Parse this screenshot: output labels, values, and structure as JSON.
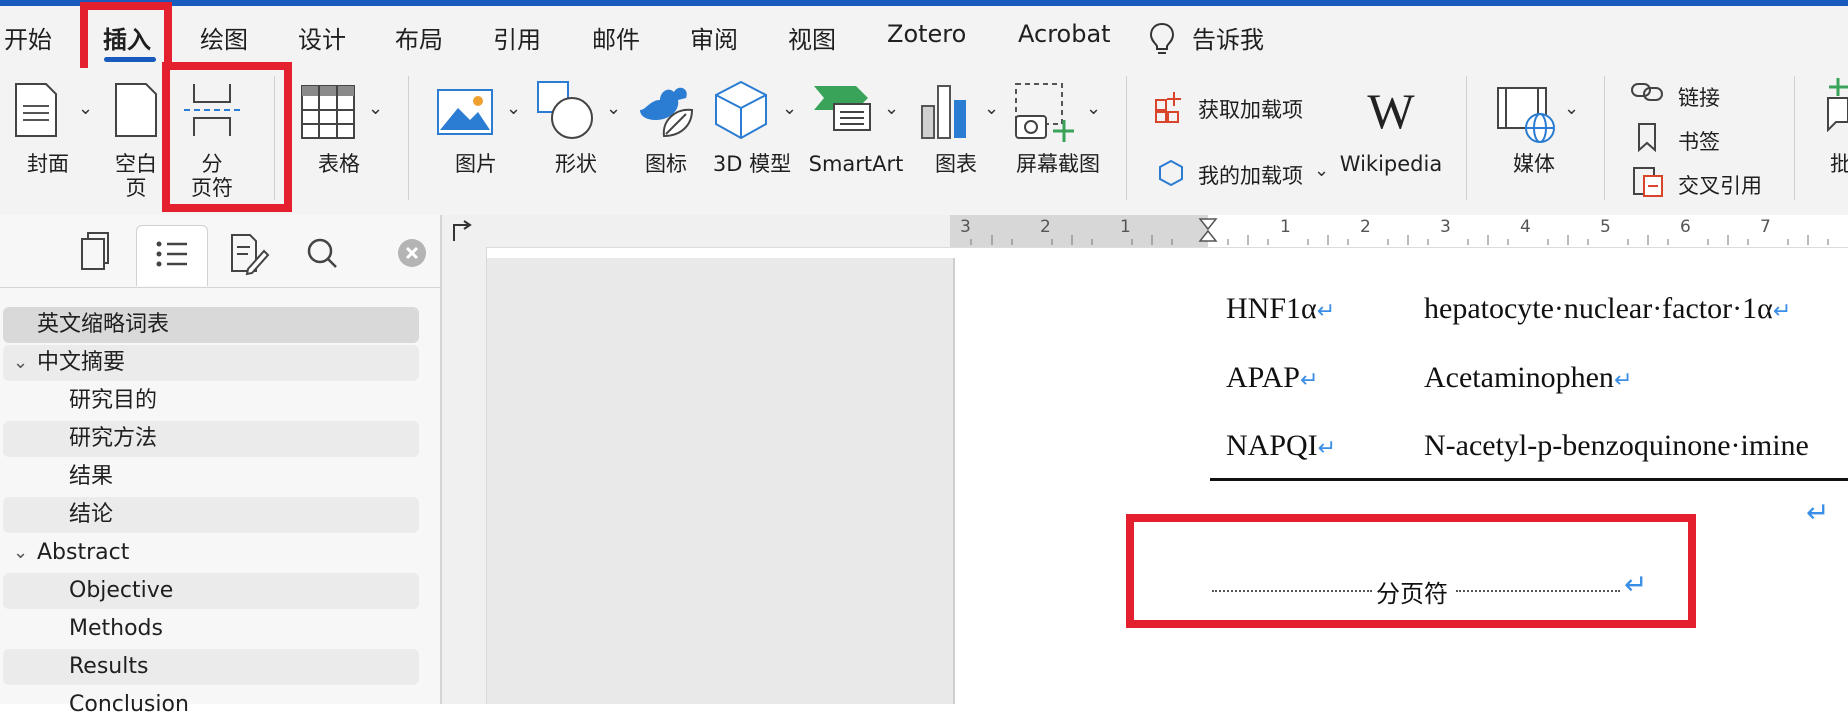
{
  "ribbon_tabs": [
    "开始",
    "插入",
    "绘图",
    "设计",
    "布局",
    "引用",
    "邮件",
    "审阅",
    "视图",
    "Zotero",
    "Acrobat",
    "告诉我"
  ],
  "active_tab": "插入",
  "ribbon": {
    "cover": "封面",
    "blank_page": [
      "空白",
      "页"
    ],
    "page_break": [
      "分",
      "页符"
    ],
    "table": "表格",
    "pictures": "图片",
    "shapes": "形状",
    "icons": "图标",
    "model3d": "3D 模型",
    "smartart": "SmartArt",
    "chart": "图表",
    "screenshot": "屏幕截图",
    "get_addins": "获取加载项",
    "my_addins": "我的加载项",
    "wikipedia_logo": "W",
    "wikipedia": "Wikipedia",
    "media": "媒体",
    "link": "链接",
    "bookmark": "书签",
    "cross_reference": "交叉引用",
    "comment_partial": "批"
  },
  "nav_pane": {
    "items": [
      {
        "label": "英文缩略词表",
        "level": 1
      },
      {
        "label": "中文摘要",
        "level": 1,
        "expanded": true
      },
      {
        "label": "研究目的",
        "level": 2
      },
      {
        "label": "研究方法",
        "level": 2
      },
      {
        "label": "结果",
        "level": 2
      },
      {
        "label": "结论",
        "level": 2
      },
      {
        "label": "Abstract",
        "level": 1,
        "expanded": true
      },
      {
        "label": "Objective",
        "level": 2
      },
      {
        "label": "Methods",
        "level": 2
      },
      {
        "label": "Results",
        "level": 2
      },
      {
        "label": "Conclusion",
        "level": 2
      }
    ],
    "selected": "英文缩略词表"
  },
  "ruler": {
    "left_numbers": [
      "3",
      "2",
      "1"
    ],
    "right_numbers": [
      "1",
      "2",
      "3",
      "4",
      "5",
      "6",
      "7"
    ]
  },
  "document": {
    "rows": [
      {
        "abbr": "HNF1α",
        "full": "hepatocyte·nuclear·factor·1α"
      },
      {
        "abbr": "APAP",
        "full": "Acetaminophen"
      },
      {
        "abbr": "NAPQI",
        "full": "N-acetyl-p-benzoquinone·imine"
      }
    ],
    "page_break_label": "分页符",
    "return_mark": "↵"
  },
  "colors": {
    "accent": "#185abd",
    "annotation_red": "#e5202e",
    "return_mark": "#3a8ee6"
  }
}
